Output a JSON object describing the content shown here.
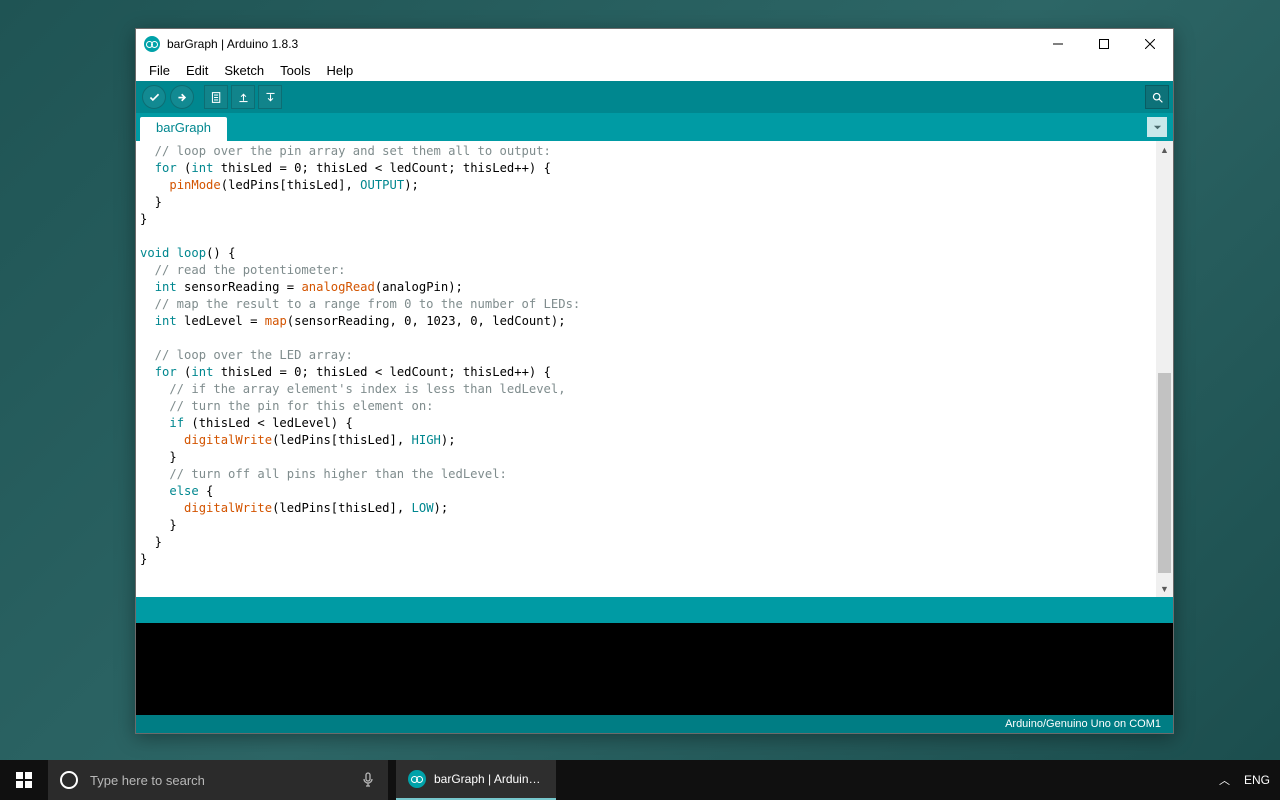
{
  "window": {
    "title": "barGraph | Arduino 1.8.3"
  },
  "menu": {
    "file": "File",
    "edit": "Edit",
    "sketch": "Sketch",
    "tools": "Tools",
    "help": "Help"
  },
  "tab": {
    "name": "barGraph"
  },
  "footer": {
    "board": "Arduino/Genuino Uno on COM1"
  },
  "code": {
    "l1": "  // loop over the pin array and set them all to output:",
    "l2a": "  ",
    "l2for": "for",
    "l2b": " (",
    "l2int": "int",
    "l2c": " thisLed = 0; thisLed < ledCount; thisLed++) {",
    "l3a": "    ",
    "l3fn": "pinMode",
    "l3b": "(ledPins[thisLed], ",
    "l3cn": "OUTPUT",
    "l3c": ");",
    "l4": "  }",
    "l5": "}",
    "l6": "",
    "l7a": "",
    "l7void": "void",
    "l7b": " ",
    "l7loop": "loop",
    "l7c": "() {",
    "l8": "  // read the potentiometer:",
    "l9a": "  ",
    "l9int": "int",
    "l9b": " sensorReading = ",
    "l9fn": "analogRead",
    "l9c": "(analogPin);",
    "l10": "  // map the result to a range from 0 to the number of LEDs:",
    "l11a": "  ",
    "l11int": "int",
    "l11b": " ledLevel = ",
    "l11fn": "map",
    "l11c": "(sensorReading, 0, 1023, 0, ledCount);",
    "l12": "",
    "l13": "  // loop over the LED array:",
    "l14a": "  ",
    "l14for": "for",
    "l14b": " (",
    "l14int": "int",
    "l14c": " thisLed = 0; thisLed < ledCount; thisLed++) {",
    "l15": "    // if the array element's index is less than ledLevel,",
    "l16": "    // turn the pin for this element on:",
    "l17a": "    ",
    "l17if": "if",
    "l17b": " (thisLed < ledLevel) {",
    "l18a": "      ",
    "l18fn": "digitalWrite",
    "l18b": "(ledPins[thisLed], ",
    "l18cn": "HIGH",
    "l18c": ");",
    "l19": "    }",
    "l20": "    // turn off all pins higher than the ledLevel:",
    "l21a": "    ",
    "l21else": "else",
    "l21b": " {",
    "l22a": "      ",
    "l22fn": "digitalWrite",
    "l22b": "(ledPins[thisLed], ",
    "l22cn": "LOW",
    "l22c": ");",
    "l23": "    }",
    "l24": "  }",
    "l25": "}"
  },
  "taskbar": {
    "search_placeholder": "Type here to search",
    "app_label": "barGraph | Arduino...",
    "lang": "ENG"
  }
}
